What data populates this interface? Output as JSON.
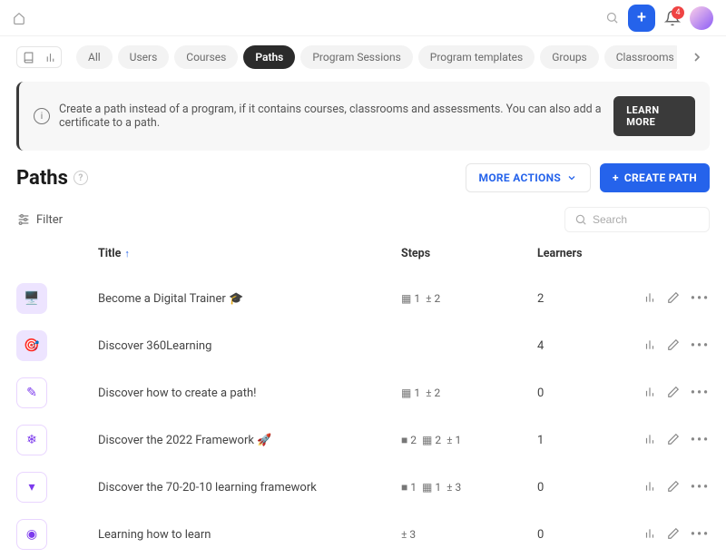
{
  "topbar": {
    "notification_count": "4"
  },
  "nav_tabs": [
    {
      "label": "All",
      "active": false
    },
    {
      "label": "Users",
      "active": false
    },
    {
      "label": "Courses",
      "active": false
    },
    {
      "label": "Paths",
      "active": true
    },
    {
      "label": "Program Sessions",
      "active": false
    },
    {
      "label": "Program templates",
      "active": false
    },
    {
      "label": "Groups",
      "active": false
    },
    {
      "label": "Classrooms",
      "active": false
    }
  ],
  "banner": {
    "text": "Create a path instead of a program, if it contains courses, classrooms and assessments. You can also add a certificate to a path.",
    "button": "LEARN MORE"
  },
  "page": {
    "title": "Paths"
  },
  "actions": {
    "more": "MORE ACTIONS",
    "create": "CREATE PATH"
  },
  "controls": {
    "filter": "Filter",
    "search_placeholder": "Search"
  },
  "columns": {
    "title": "Title",
    "steps": "Steps",
    "learners": "Learners"
  },
  "rows": [
    {
      "icon_glyph": "🖥️",
      "icon_outlined": false,
      "title": "Become a Digital Trainer 🎓",
      "steps": [
        {
          "glyph": "▦",
          "n": "1"
        },
        {
          "glyph": "±",
          "n": "2"
        }
      ],
      "learners": "2"
    },
    {
      "icon_glyph": "🎯",
      "icon_outlined": false,
      "title": "Discover 360Learning",
      "steps": [],
      "learners": "4"
    },
    {
      "icon_glyph": "✎",
      "icon_outlined": true,
      "title": "Discover how to create a path!",
      "steps": [
        {
          "glyph": "▦",
          "n": "1"
        },
        {
          "glyph": "±",
          "n": "2"
        }
      ],
      "learners": "0"
    },
    {
      "icon_glyph": "❄",
      "icon_outlined": true,
      "title": "Discover the 2022 Framework 🚀",
      "steps": [
        {
          "glyph": "■",
          "n": "2"
        },
        {
          "glyph": "▦",
          "n": "2"
        },
        {
          "glyph": "±",
          "n": "1"
        }
      ],
      "learners": "1"
    },
    {
      "icon_glyph": "▾",
      "icon_outlined": true,
      "title": "Discover the 70-20-10 learning framework",
      "steps": [
        {
          "glyph": "■",
          "n": "1"
        },
        {
          "glyph": "▦",
          "n": "1"
        },
        {
          "glyph": "±",
          "n": "3"
        }
      ],
      "learners": "0"
    },
    {
      "icon_glyph": "◉",
      "icon_outlined": true,
      "title": "Learning how to learn",
      "steps": [
        {
          "glyph": "±",
          "n": "3"
        }
      ],
      "learners": "0"
    }
  ]
}
